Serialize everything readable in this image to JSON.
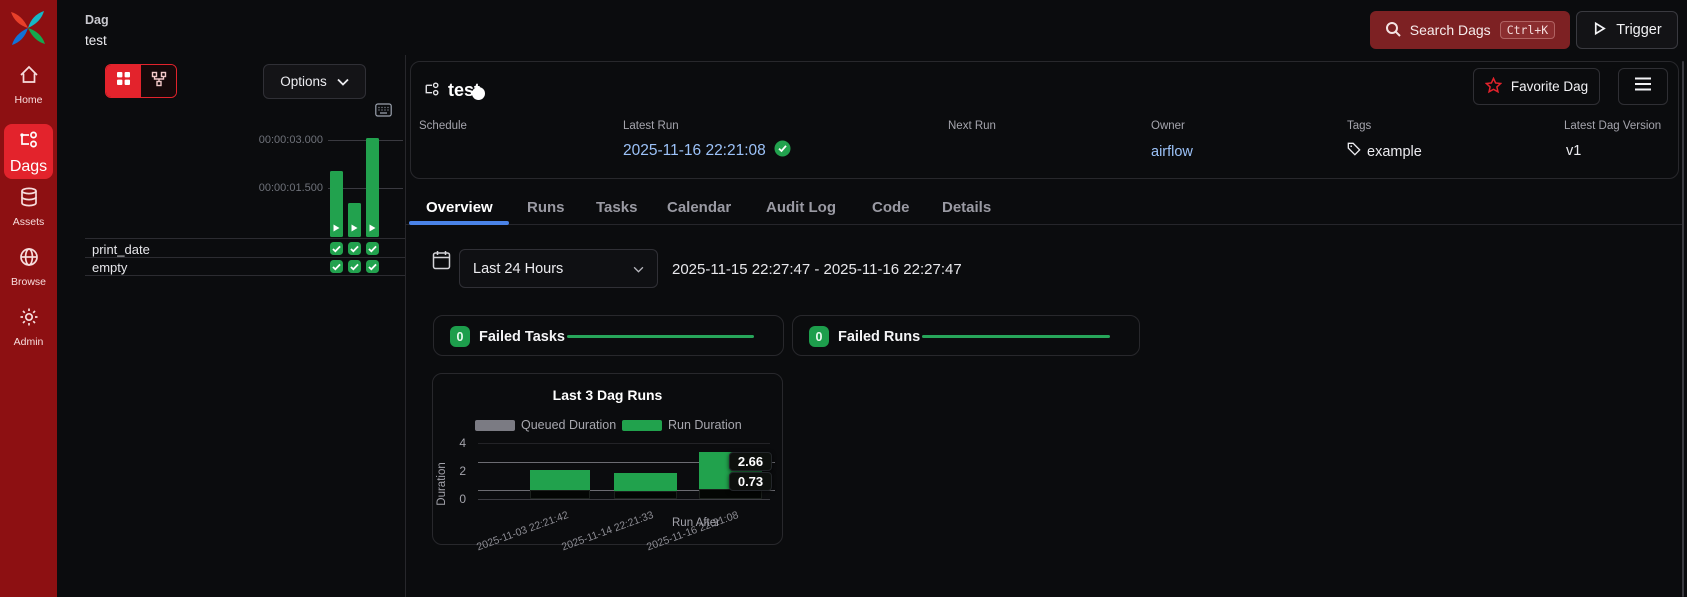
{
  "colors": {
    "accent_red": "#e3232c",
    "sidebar_red": "#8d1012",
    "green": "#22a24e",
    "link_blue": "#9cc2f8",
    "tab_underline": "#4a83e8"
  },
  "topbar": {
    "breadcrumb": "Dag",
    "breadcrumb_dag": "test",
    "search_label": "Search Dags",
    "search_shortcut": "Ctrl+K",
    "trigger_label": "Trigger"
  },
  "sidebar": {
    "items": [
      {
        "label": "Home",
        "icon": "home-icon",
        "active": false
      },
      {
        "label": "Dags",
        "icon": "dag-icon",
        "active": true
      },
      {
        "label": "Assets",
        "icon": "database-icon",
        "active": false
      },
      {
        "label": "Browse",
        "icon": "globe-icon",
        "active": false
      },
      {
        "label": "Admin",
        "icon": "gear-icon",
        "active": false
      }
    ]
  },
  "left_panel": {
    "options_label": "Options",
    "time_axis": [
      "00:00:03.000",
      "00:00:01.500"
    ],
    "gantt_bar_seconds": [
      2.05,
      1.05,
      3.1
    ],
    "tasks": [
      {
        "name": "print_date",
        "statuses": [
          "success",
          "success",
          "success"
        ]
      },
      {
        "name": "empty",
        "statuses": [
          "success",
          "success",
          "success"
        ]
      }
    ]
  },
  "dag_header": {
    "title": "test",
    "enabled": true,
    "favorite_label": "Favorite Dag",
    "fields": [
      {
        "label": "Schedule",
        "value": ""
      },
      {
        "label": "Latest Run",
        "value": "2025-11-16 22:21:08",
        "status": "success"
      },
      {
        "label": "Next Run",
        "value": ""
      },
      {
        "label": "Owner",
        "value": "airflow"
      },
      {
        "label": "Tags",
        "value": "example"
      },
      {
        "label": "Latest Dag Version",
        "value": "v1"
      }
    ]
  },
  "tabs": {
    "active": "Overview",
    "items": [
      {
        "label": "Overview"
      },
      {
        "label": "Runs"
      },
      {
        "label": "Tasks"
      },
      {
        "label": "Calendar"
      },
      {
        "label": "Audit Log"
      },
      {
        "label": "Code"
      },
      {
        "label": "Details"
      }
    ]
  },
  "filters": {
    "preset": "Last 24 Hours",
    "range": "2025-11-15 22:27:47 - 2025-11-16 22:27:47"
  },
  "stats": [
    {
      "count": "0",
      "label": "Failed Tasks"
    },
    {
      "count": "0",
      "label": "Failed Runs"
    }
  ],
  "chart_data": {
    "type": "bar",
    "title": "Last 3 Dag Runs",
    "x": [
      "2025-11-03 22:21:42",
      "2025-11-14 22:21:33",
      "2025-11-16 22:21:08"
    ],
    "series": [
      {
        "name": "Queued Duration",
        "color": "#7b7b83",
        "values": [
          0.62,
          0.6,
          0.73
        ]
      },
      {
        "name": "Run Duration",
        "color": "#21a24d",
        "values": [
          1.45,
          1.25,
          2.66
        ]
      }
    ],
    "stacked": true,
    "ylabel": "Duration",
    "xlabel": "Run After",
    "yticks": [
      "4",
      "2",
      "0"
    ],
    "ylim": [
      0,
      4
    ],
    "legend_position": "top",
    "tooltip": {
      "run": "2.66",
      "queued": "0.73"
    }
  }
}
